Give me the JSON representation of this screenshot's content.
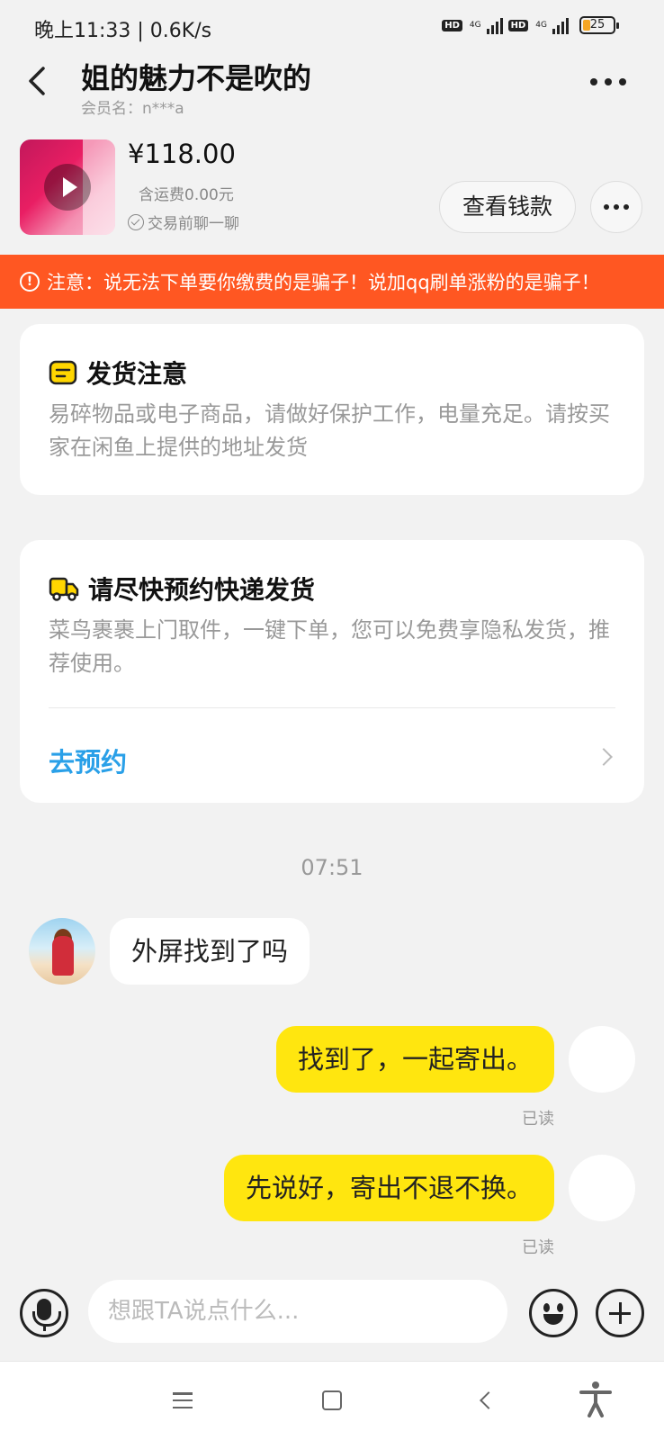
{
  "status_bar": {
    "time": "晚上11:33 | 0.6K/s",
    "network_badge": "HD",
    "network_type": "4G",
    "battery": "25",
    "battery_fraction": 0.25
  },
  "header": {
    "title": "姐的魅力不是吹的",
    "member_name": "会员名：n***a"
  },
  "product": {
    "price": "¥118.00",
    "shipping": "含运费0.00元",
    "chat_before_trade": "交易前聊一聊",
    "view_payment_label": "查看钱款"
  },
  "warning": {
    "text": "注意：说无法下单要你缴费的是骗子！说加qq刷单涨粉的是骗子！",
    "color": "#ff5722"
  },
  "shipping_notice": {
    "title": "发货注意",
    "body": "易碎物品或电子商品，请做好保护工作，电量充足。请按买家在闲鱼上提供的地址发货"
  },
  "courier_card": {
    "title": "请尽快预约快递发货",
    "body": "菜鸟裹裹上门取件，一键下单，您可以免费享隐私发货，推荐使用。",
    "link_label": "去预约",
    "link_color": "#2aa0e8"
  },
  "chat": {
    "timestamp": "07:51",
    "messages": [
      {
        "from": "other",
        "text": "外屏找到了吗"
      },
      {
        "from": "me",
        "text": "找到了，一起寄出。",
        "status": "已读"
      },
      {
        "from": "me",
        "text": "先说好，寄出不退不换。",
        "status": "已读"
      }
    ],
    "bubble_out_color": "#ffe60f"
  },
  "input_bar": {
    "placeholder": "想跟TA说点什么...",
    "value": ""
  },
  "icons": {
    "back": "back-arrow-icon",
    "more": "more-dots-icon",
    "play": "play-icon",
    "check": "check-circle-icon",
    "warning": "warning-icon",
    "notice": "notice-icon",
    "truck": "truck-icon",
    "mic": "microphone-icon",
    "emoji": "emoji-icon",
    "plus": "plus-icon"
  }
}
